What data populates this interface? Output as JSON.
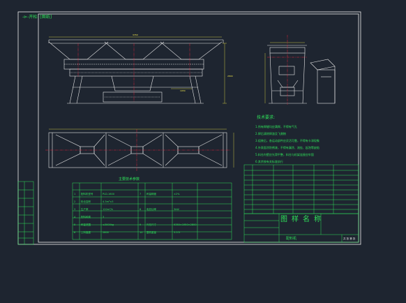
{
  "viewer": {
    "tab_label": "-⊳-开松- [图纸]"
  },
  "drawing": {
    "notes_title": "技术要求:",
    "notes": [
      "1.所有焊缝均应满焊，不得有气孔",
      "2.焊后清除焊渣及飞溅物",
      "3.组装后，各运动部件应灵活可靠，不得有卡滞现象",
      "4.外表面涂防锈漆，不得有漏涂、流挂、起泡等缺陷",
      "5.料仓内壁应光滑平整，料仓与机架连接应牢固",
      "6.其余按有关标准执行"
    ],
    "title_block": {
      "name": "图样名称",
      "sub": "配料机",
      "scale_note": "共 张 第 张"
    },
    "params_table_title": "主要技术参数",
    "params_rows": [
      [
        "1",
        "配料机型号",
        "PLD-1600",
        "7",
        "称量精度",
        "±2%"
      ],
      [
        "2",
        "料仓容积",
        "4.3m³×3",
        "",
        "",
        ""
      ],
      [
        "3",
        "生产率",
        "120m³/h",
        "8",
        "电机功率",
        "3kW"
      ],
      [
        "4",
        "配料种类",
        "3",
        "",
        "",
        ""
      ],
      [
        "5",
        "称量范围",
        "≤3000kg",
        "9",
        "外形尺寸",
        "9350×1950×2800"
      ],
      [
        "6",
        "上料高度",
        "2800",
        "10",
        "整机重量",
        "3.57t"
      ]
    ],
    "dims": {
      "overall_length": "9350",
      "height": "2800",
      "left_block": "1950"
    }
  },
  "colors": {
    "background": "#1e2530",
    "frame": "#f0f0f0",
    "hatch": "#e8e8e8",
    "annotation_green": "#2fe35a",
    "table_green": "#2fe35a",
    "center_line": "#e0243a",
    "dim_yellow": "#f2e84a"
  }
}
